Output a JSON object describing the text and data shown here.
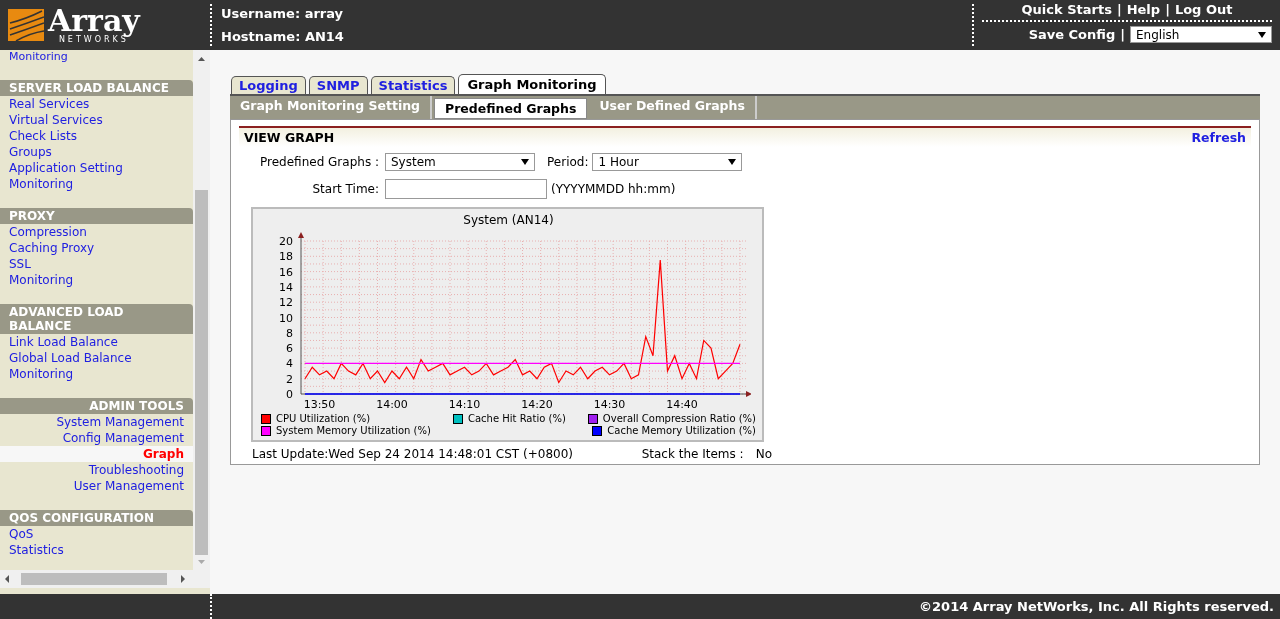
{
  "header": {
    "logo": {
      "word": "Array",
      "subtitle": "NETWORKS"
    },
    "username": "Username: array",
    "hostname": "Hostname: AN14",
    "top_links": [
      "Quick Starts",
      "Help",
      "Log Out"
    ],
    "separators": [
      "|",
      "|"
    ],
    "save_config": "Save Config",
    "save_separator": "|",
    "language": {
      "value": "English"
    }
  },
  "sidebar": {
    "cut_item": "Monitoring",
    "sections": [
      {
        "title": "SERVER LOAD BALANCE",
        "kind": "standard",
        "items": [
          {
            "label": "Real Services",
            "selected": false
          },
          {
            "label": "Virtual Services",
            "selected": false
          },
          {
            "label": "Check Lists",
            "selected": false
          },
          {
            "label": "Groups",
            "selected": false
          },
          {
            "label": "Application Setting",
            "selected": false
          },
          {
            "label": "Monitoring",
            "selected": false
          }
        ]
      },
      {
        "title": "PROXY",
        "kind": "standard",
        "items": [
          {
            "label": "Compression",
            "selected": false
          },
          {
            "label": "Caching Proxy",
            "selected": false
          },
          {
            "label": "SSL",
            "selected": false
          },
          {
            "label": "Monitoring",
            "selected": false
          }
        ]
      },
      {
        "title": "ADVANCED LOAD BALANCE",
        "kind": "standard",
        "items": [
          {
            "label": "Link Load Balance",
            "selected": false
          },
          {
            "label": "Global Load Balance",
            "selected": false
          },
          {
            "label": "Monitoring",
            "selected": false
          }
        ]
      },
      {
        "title": "ADMIN TOOLS",
        "kind": "admin",
        "items": [
          {
            "label": "System Management",
            "selected": false
          },
          {
            "label": "Config Management",
            "selected": false
          },
          {
            "label": "Graph",
            "selected": true
          },
          {
            "label": "Troubleshooting",
            "selected": false
          },
          {
            "label": "User Management",
            "selected": false
          }
        ]
      },
      {
        "title": "QOS CONFIGURATION",
        "kind": "standard",
        "items": [
          {
            "label": "QoS",
            "selected": false
          },
          {
            "label": "Statistics",
            "selected": false
          }
        ]
      }
    ]
  },
  "tabs": [
    {
      "label": "Logging",
      "selected": false
    },
    {
      "label": "SNMP",
      "selected": false
    },
    {
      "label": "Statistics",
      "selected": false
    },
    {
      "label": "Graph Monitoring",
      "selected": true
    }
  ],
  "subtabs": [
    {
      "label": "Graph Monitoring Setting",
      "selected": false
    },
    {
      "label": "Predefined Graphs",
      "selected": true
    },
    {
      "label": "User Defined Graphs",
      "selected": false
    }
  ],
  "panel": {
    "title": "VIEW GRAPH",
    "refresh": "Refresh",
    "predefined_label": "Predefined Graphs :",
    "predefined_value": "System",
    "period_label": "Period:",
    "period_value": "1 Hour",
    "start_time_label": "Start Time:",
    "start_time_hint": "(YYYYMMDD hh:mm)",
    "chart_data": {
      "type": "line",
      "title": "System (AN14)",
      "grid": true,
      "categories": [
        null,
        null,
        "13:50",
        null,
        null,
        null,
        null,
        null,
        null,
        null,
        null,
        null,
        "14:00",
        null,
        null,
        null,
        null,
        null,
        null,
        null,
        null,
        null,
        "14:10",
        null,
        null,
        null,
        null,
        null,
        null,
        null,
        null,
        null,
        "14:20",
        null,
        null,
        null,
        null,
        null,
        null,
        null,
        null,
        null,
        "14:30",
        null,
        null,
        null,
        null,
        null,
        null,
        null,
        null,
        null,
        "14:40",
        null,
        null,
        null,
        null,
        null,
        null,
        null,
        null
      ],
      "ylim": [
        0,
        20
      ],
      "yticks": [
        0,
        2,
        4,
        6,
        8,
        10,
        12,
        14,
        16,
        18,
        20
      ],
      "series": [
        {
          "name": "CPU Utilization (%)",
          "color": "#ff0000",
          "values": [
            2,
            3.5,
            2.5,
            3,
            2,
            4,
            3,
            2.5,
            4,
            2,
            3,
            1.5,
            3,
            2,
            3.5,
            2,
            4.5,
            3,
            3.5,
            4,
            2.5,
            3,
            3.5,
            2.5,
            3,
            4,
            2.5,
            3,
            3.5,
            4.5,
            2.5,
            3,
            2,
            3.5,
            4,
            1.5,
            3,
            2.5,
            3.5,
            2,
            3,
            3.5,
            2.5,
            3,
            4,
            2,
            2.5,
            7.5,
            5,
            17.5,
            3,
            5,
            2,
            4,
            2,
            7,
            6,
            2,
            3,
            4,
            6.5
          ]
        },
        {
          "name": "Cache Hit Ratio (%)",
          "color": "#00c0c0",
          "values": [
            null,
            null,
            null,
            null,
            null,
            null,
            null,
            null,
            null,
            null,
            null,
            null,
            null,
            null,
            null,
            null,
            null,
            null,
            null,
            null,
            null,
            null,
            null,
            null,
            null,
            null,
            null,
            null,
            null,
            null,
            null,
            null,
            null,
            null,
            null,
            null,
            null,
            null,
            null,
            null,
            null,
            null,
            null,
            null,
            null,
            null,
            null,
            null,
            null,
            null,
            null,
            null,
            null,
            null,
            null,
            null,
            null,
            null,
            null,
            null,
            null
          ]
        },
        {
          "name": "Overall Compression Ratio (%)",
          "color": "#a020f0",
          "values": [
            null,
            null,
            null,
            null,
            null,
            null,
            null,
            null,
            null,
            null,
            null,
            null,
            null,
            null,
            null,
            null,
            null,
            null,
            null,
            null,
            null,
            null,
            null,
            null,
            null,
            null,
            null,
            null,
            null,
            null,
            null,
            null,
            null,
            null,
            null,
            null,
            null,
            null,
            null,
            null,
            null,
            null,
            null,
            null,
            null,
            null,
            null,
            null,
            null,
            null,
            null,
            null,
            null,
            null,
            null,
            null,
            null,
            null,
            null,
            null,
            null
          ]
        },
        {
          "name": "System Memory Utilization (%)",
          "color": "#ff00ff",
          "values": [
            4,
            4,
            4,
            4,
            4,
            4,
            4,
            4,
            4,
            4,
            4,
            4,
            4,
            4,
            4,
            4,
            4,
            4,
            4,
            4,
            4,
            4,
            4,
            4,
            4,
            4,
            4,
            4,
            4,
            4,
            4,
            4,
            4,
            4,
            4,
            4,
            4,
            4,
            4,
            4,
            4,
            4,
            4,
            4,
            4,
            4,
            4,
            4,
            4,
            4,
            4,
            4,
            4,
            4,
            4,
            4,
            4,
            4,
            4,
            4,
            4
          ]
        },
        {
          "name": "Cache Memory Utilization (%)",
          "color": "#0000ff",
          "values": [
            0,
            0,
            0,
            0,
            0,
            0,
            0,
            0,
            0,
            0,
            0,
            0,
            0,
            0,
            0,
            0,
            0,
            0,
            0,
            0,
            0,
            0,
            0,
            0,
            0,
            0,
            0,
            0,
            0,
            0,
            0,
            0,
            0,
            0,
            0,
            0,
            0,
            0,
            0,
            0,
            0,
            0,
            0,
            0,
            0,
            0,
            0,
            0,
            0,
            0,
            0,
            0,
            0,
            0,
            0,
            0,
            0,
            0,
            0,
            0,
            0
          ]
        }
      ]
    },
    "last_update": "Last Update:Wed Sep 24 2014 14:48:01 CST (+0800)",
    "stack_label": "Stack the Items :",
    "stack_value": "No"
  },
  "footer": "©2014 Array NetWorks, Inc. All Rights reserved."
}
